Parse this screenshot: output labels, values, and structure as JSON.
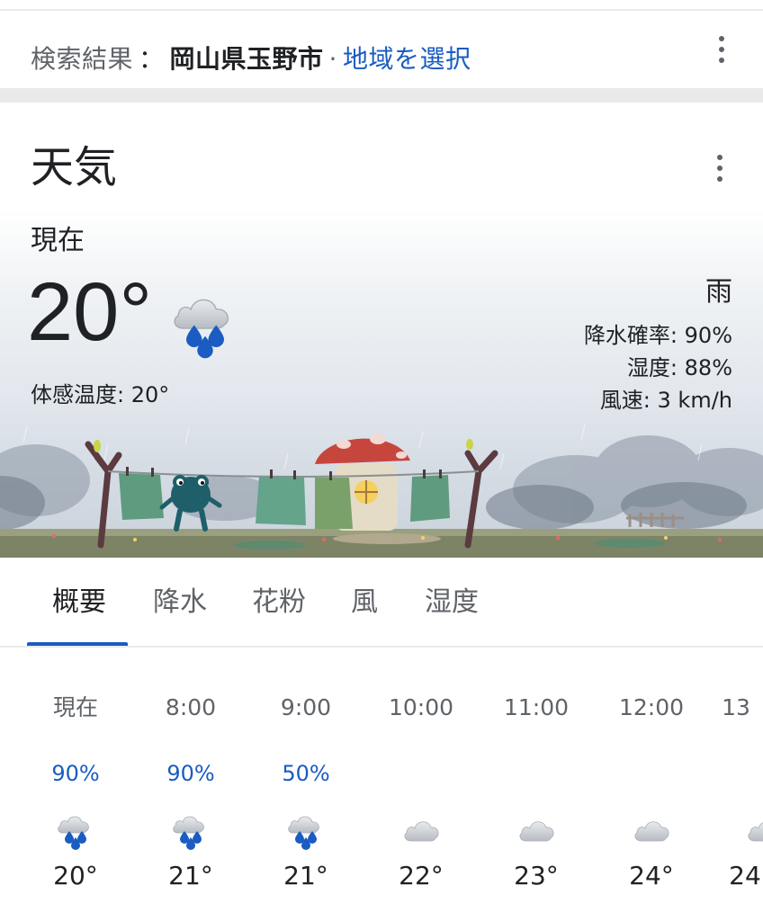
{
  "search": {
    "prefix": "検索結果",
    "separator": "：",
    "location": "岡山県玉野市",
    "dot": "·",
    "select_region": "地域を選択"
  },
  "weather": {
    "title": "天気",
    "now_label": "現在",
    "temperature": "20°",
    "feels_like": "体感温度: 20°",
    "condition": "雨",
    "precip_chance": "降水確率: 90%",
    "humidity": "湿度: 88%",
    "wind": "風速: 3 km/h",
    "icon": "cloud-rain-icon"
  },
  "tabs": [
    {
      "label": "概要",
      "active": true
    },
    {
      "label": "降水",
      "active": false
    },
    {
      "label": "花粉",
      "active": false
    },
    {
      "label": "風",
      "active": false
    },
    {
      "label": "湿度",
      "active": false
    }
  ],
  "hourly": [
    {
      "time": "現在",
      "precip": "90%",
      "icon": "cloud-rain-icon",
      "temp": "20°"
    },
    {
      "time": "8:00",
      "precip": "90%",
      "icon": "cloud-rain-icon",
      "temp": "21°"
    },
    {
      "time": "9:00",
      "precip": "50%",
      "icon": "cloud-rain-icon",
      "temp": "21°"
    },
    {
      "time": "10:00",
      "precip": "",
      "icon": "cloud-icon",
      "temp": "22°"
    },
    {
      "time": "11:00",
      "precip": "",
      "icon": "cloud-icon",
      "temp": "23°"
    },
    {
      "time": "12:00",
      "precip": "",
      "icon": "cloud-icon",
      "temp": "24°"
    },
    {
      "time": "13",
      "precip": "",
      "icon": "cloud-icon",
      "temp": "24"
    }
  ],
  "colors": {
    "accent": "#1a5cc1",
    "text_primary": "#202124",
    "text_secondary": "#5f6368",
    "rain_drop": "#1a5cc1"
  }
}
